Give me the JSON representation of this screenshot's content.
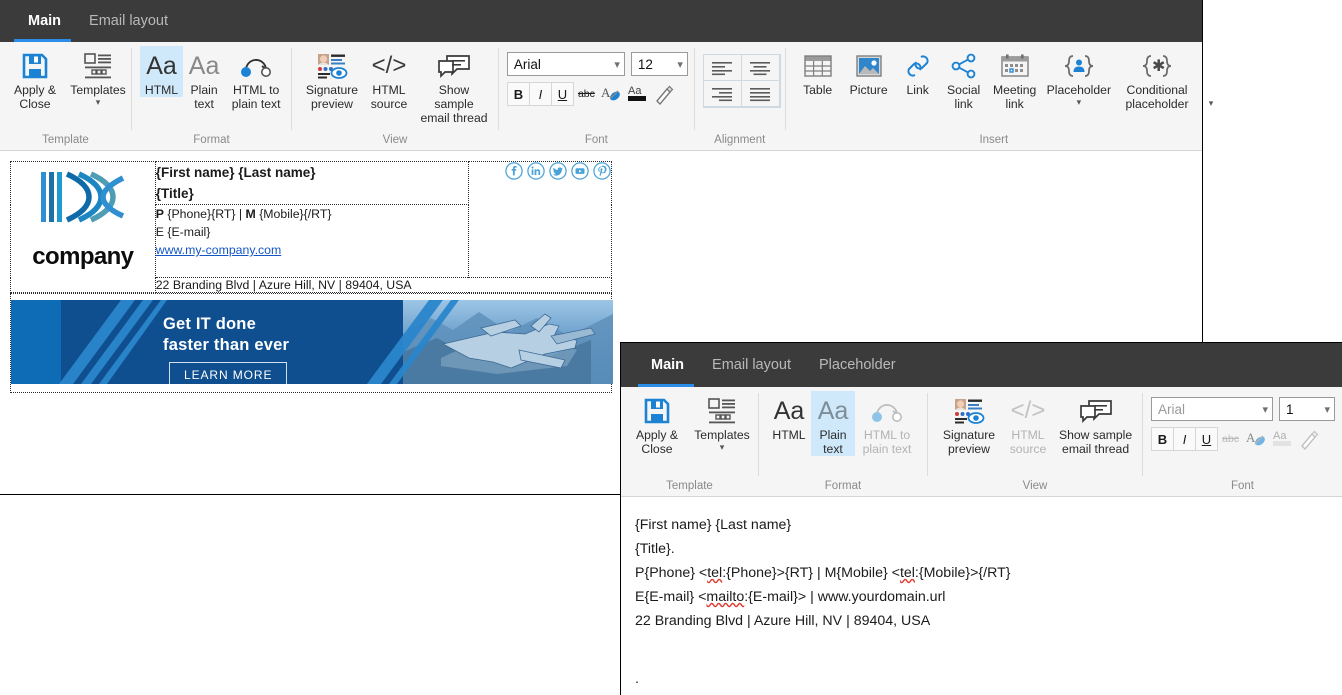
{
  "window_main": {
    "tabs": [
      {
        "label": "Main",
        "active": true
      },
      {
        "label": "Email layout",
        "active": false
      }
    ],
    "ribbon": {
      "groups": [
        {
          "name": "Template",
          "label": "Template",
          "buttons": [
            {
              "label": "Apply &\nClose",
              "icon": "save-icon",
              "state": "normal"
            },
            {
              "label": "Templates",
              "icon": "templates-icon",
              "state": "normal",
              "dropdown": true
            }
          ]
        },
        {
          "name": "Format",
          "label": "Format",
          "buttons": [
            {
              "label": "HTML",
              "icon": "aa-icon",
              "state": "selected"
            },
            {
              "label": "Plain\ntext",
              "icon": "aa-icon",
              "state": "normal"
            },
            {
              "label": "HTML to\nplain text",
              "icon": "convert-arrow-icon",
              "state": "normal"
            }
          ]
        },
        {
          "name": "View",
          "label": "View",
          "buttons": [
            {
              "label": "Signature\npreview",
              "icon": "signature-preview-icon",
              "state": "normal"
            },
            {
              "label": "HTML\nsource",
              "icon": "code-brackets-icon",
              "state": "normal"
            },
            {
              "label": "Show sample\nemail thread",
              "icon": "chat-bubbles-icon",
              "state": "normal"
            }
          ]
        },
        {
          "name": "Font",
          "label": "Font",
          "font_family": {
            "value": "Arial",
            "placeholder": "Arial"
          },
          "font_size": {
            "value": "12",
            "placeholder": "12"
          },
          "format_buttons": [
            {
              "label": "B",
              "name": "bold-button",
              "state": "normal"
            },
            {
              "label": "I",
              "name": "italic-button",
              "state": "normal"
            },
            {
              "label": "U",
              "name": "underline-button",
              "state": "normal"
            },
            {
              "label": "abc",
              "name": "strikethrough-button",
              "state": "normal"
            },
            {
              "label": "A",
              "name": "font-color-button",
              "state": "normal"
            },
            {
              "label": "Aa",
              "name": "highlight-color-button",
              "state": "normal"
            },
            {
              "label": "pencil",
              "name": "format-painter-button",
              "state": "normal"
            }
          ]
        },
        {
          "name": "Alignment",
          "label": "Alignment",
          "buttons": [
            {
              "name": "align-left-button"
            },
            {
              "name": "align-center-button"
            },
            {
              "name": "align-right-button"
            },
            {
              "name": "align-justify-button"
            }
          ]
        },
        {
          "name": "Insert",
          "label": "Insert",
          "buttons": [
            {
              "label": "Table",
              "icon": "table-icon",
              "state": "normal"
            },
            {
              "label": "Picture",
              "icon": "picture-icon",
              "state": "normal"
            },
            {
              "label": "Link",
              "icon": "link-chain-icon",
              "state": "normal"
            },
            {
              "label": "Social\nlink",
              "icon": "share-nodes-icon",
              "state": "normal"
            },
            {
              "label": "Meeting\nlink",
              "icon": "calendar-icon",
              "state": "normal"
            },
            {
              "label": "Placeholder",
              "icon": "placeholder-person-icon",
              "state": "normal",
              "dropdown": true
            },
            {
              "label": "Conditional\nplaceholder",
              "icon": "placeholder-asterisk-icon",
              "state": "normal",
              "dropdown": true
            }
          ]
        }
      ]
    },
    "signature": {
      "logo_text": "company",
      "name_line": "{First name} {Last name}",
      "title_line": "{Title}",
      "phone_prefix": "P",
      "phone_text": " {Phone}{RT} | ",
      "mobile_prefix": "M",
      "mobile_text": " {Mobile}{/RT}",
      "email_line": "E {E-mail}",
      "website": "www.my-company.com",
      "address": "22 Branding Blvd | Azure Hill, NV | 89404, USA",
      "social_icons": [
        "facebook-icon",
        "linkedin-icon",
        "twitter-icon",
        "youtube-icon",
        "pinterest-icon"
      ],
      "banner": {
        "headline_line1": "Get IT done",
        "headline_line2": "faster than ever",
        "cta_label": "LEARN MORE"
      }
    }
  },
  "window_plain": {
    "tabs": [
      {
        "label": "Main",
        "active": true
      },
      {
        "label": "Email layout",
        "active": false
      },
      {
        "label": "Placeholder",
        "active": false
      }
    ],
    "ribbon": {
      "groups": [
        {
          "name": "Template",
          "label": "Template",
          "buttons": [
            {
              "label": "Apply &\nClose",
              "icon": "save-icon",
              "state": "normal"
            },
            {
              "label": "Templates",
              "icon": "templates-icon",
              "state": "normal",
              "dropdown": true
            }
          ]
        },
        {
          "name": "Format",
          "label": "Format",
          "buttons": [
            {
              "label": "HTML",
              "icon": "aa-icon",
              "state": "normal"
            },
            {
              "label": "Plain\ntext",
              "icon": "aa-icon",
              "state": "selected"
            },
            {
              "label": "HTML to\nplain text",
              "icon": "convert-arrow-icon",
              "state": "disabled"
            }
          ]
        },
        {
          "name": "View",
          "label": "View",
          "buttons": [
            {
              "label": "Signature\npreview",
              "icon": "signature-preview-icon",
              "state": "normal"
            },
            {
              "label": "HTML\nsource",
              "icon": "code-brackets-icon",
              "state": "disabled"
            },
            {
              "label": "Show sample\nemail thread",
              "icon": "chat-bubbles-icon",
              "state": "normal"
            }
          ]
        },
        {
          "name": "Font",
          "label": "Font",
          "font_family": {
            "value": "",
            "placeholder": "Arial"
          },
          "font_size": {
            "value": "1",
            "placeholder": "1"
          },
          "format_buttons": [
            {
              "label": "B",
              "name": "bold-button",
              "state": "normal"
            },
            {
              "label": "I",
              "name": "italic-button",
              "state": "normal"
            },
            {
              "label": "U",
              "name": "underline-button",
              "state": "normal"
            },
            {
              "label": "abc",
              "name": "strikethrough-button",
              "state": "disabled"
            },
            {
              "label": "A",
              "name": "font-color-button",
              "state": "normal"
            },
            {
              "label": "Aa",
              "name": "highlight-color-button",
              "state": "disabled"
            },
            {
              "label": "pencil",
              "name": "format-painter-button",
              "state": "disabled"
            }
          ]
        }
      ]
    },
    "body": {
      "lines": [
        "{First name} {Last name}",
        "{Title}.",
        "P{Phone} <tel:{Phone}>{RT} | M{Mobile} <tel:{Mobile}>{/RT}",
        "E{E-mail} <mailto:{E-mail}> | www.yourdomain.url",
        "22 Branding Blvd | Azure Hill, NV | 89404, USA"
      ],
      "trailing": "."
    }
  },
  "colors": {
    "accent": "#2a8dea",
    "tabbar_bg": "#3b3b3b",
    "ribbon_bg": "#f5f5f5",
    "selection": "#cfe8fa",
    "link": "#1456c4",
    "banner_blue": "#0f4f8f",
    "logo_blue": "#1b7fc4",
    "social_blue": "#4aa3d8"
  }
}
